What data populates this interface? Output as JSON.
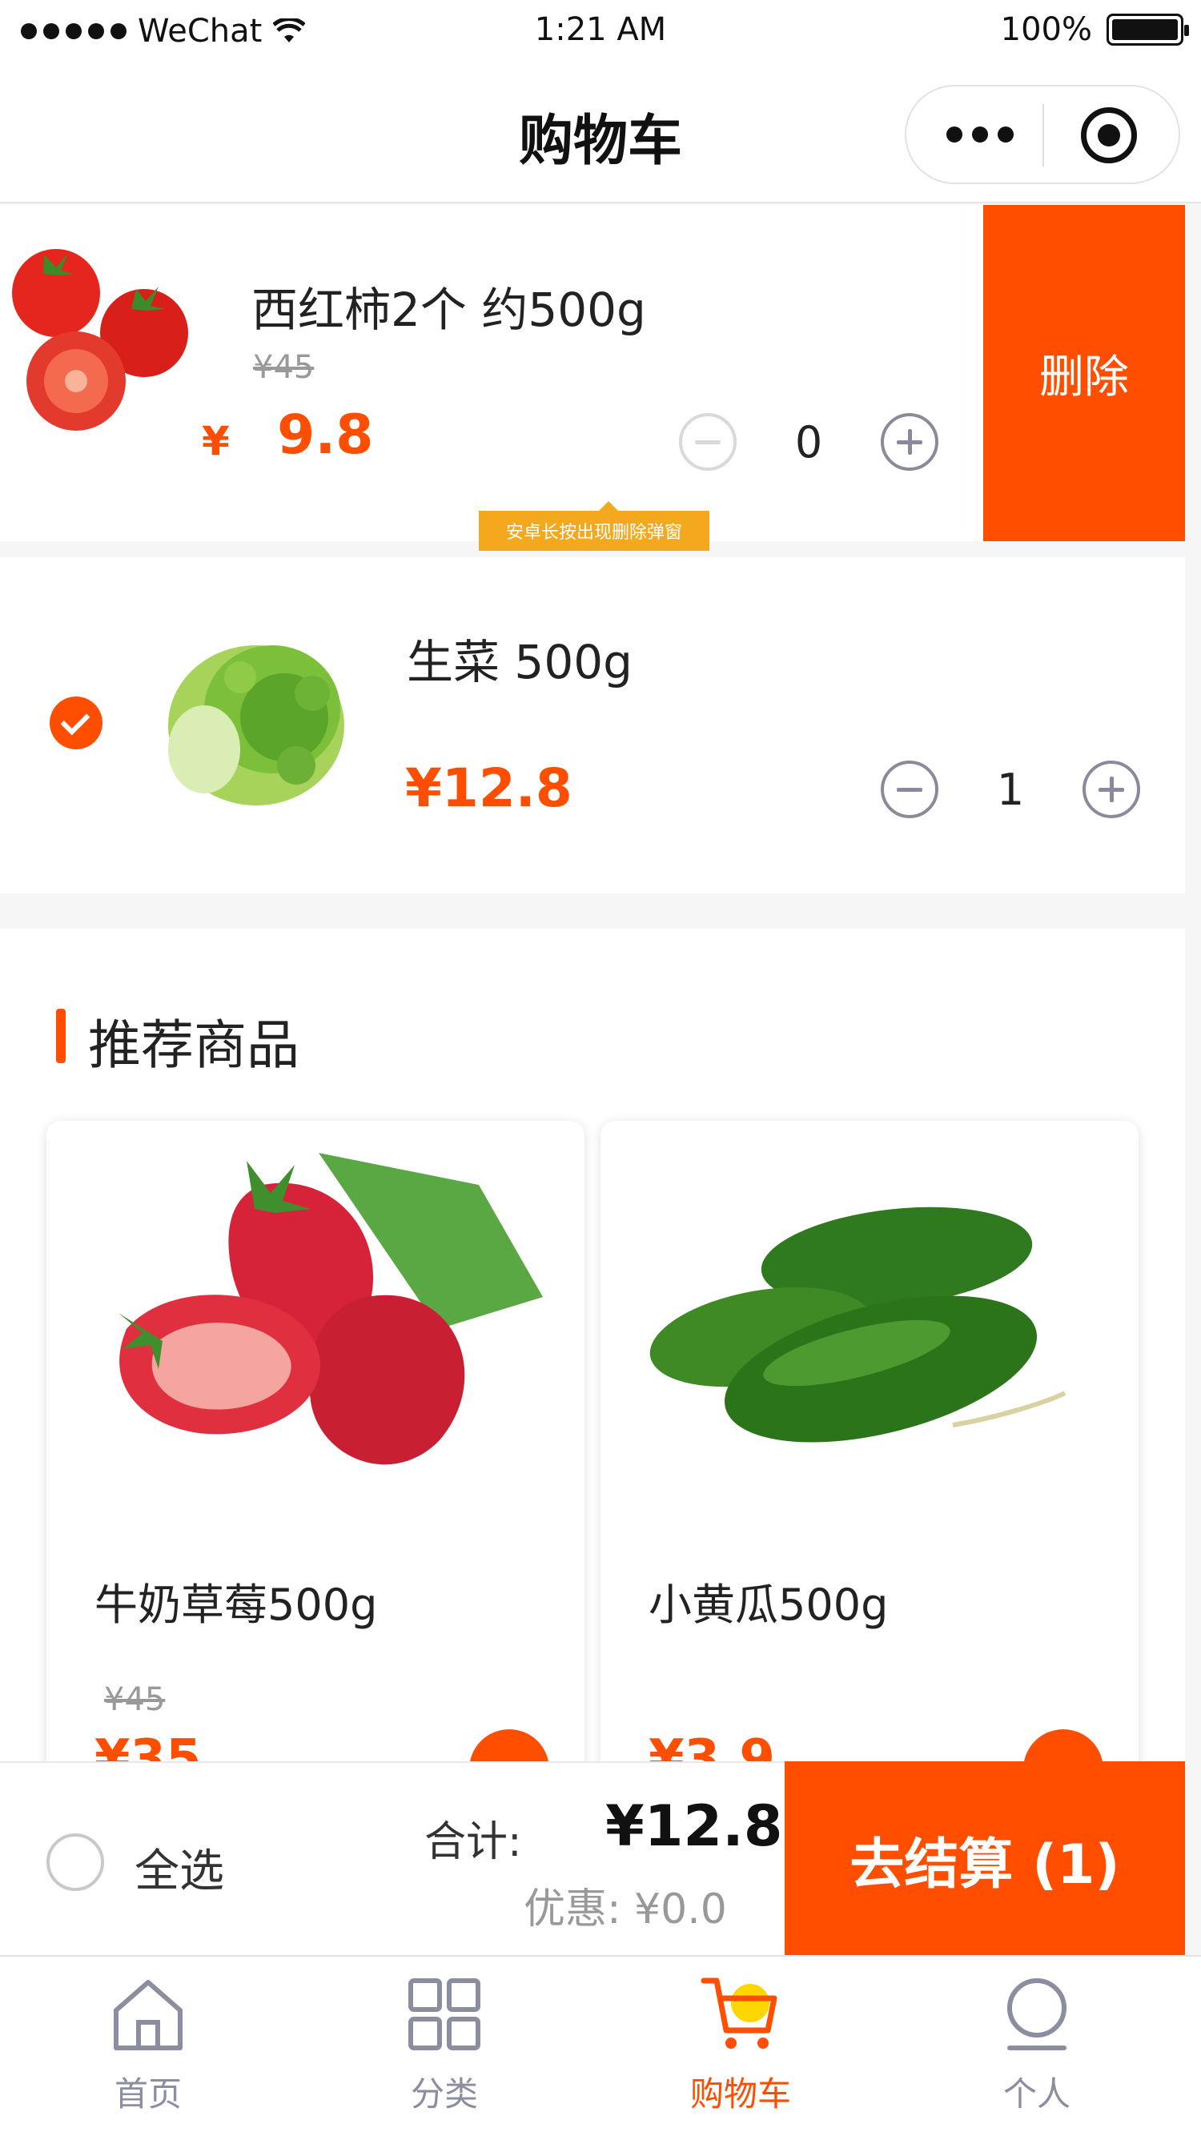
{
  "status_bar": {
    "carrier": "WeChat",
    "time": "1:21 AM",
    "battery": "100%"
  },
  "nav": {
    "title": "购物车"
  },
  "cart_items": [
    {
      "name": "西红柿2个 约500g",
      "old_price": "¥45",
      "currency": "¥",
      "price": "9.8",
      "quantity": "0",
      "delete_label": "删除",
      "checked": false
    },
    {
      "name": "生菜 500g",
      "price": "¥12.8",
      "quantity": "1",
      "checked": true
    }
  ],
  "tooltip": "安卓长按出现删除弹窗",
  "recommend": {
    "title": "推荐商品",
    "items": [
      {
        "name": "牛奶草莓500g",
        "old_price": "¥45",
        "price": "¥35"
      },
      {
        "name": "小黄瓜500g",
        "price": "¥3.9"
      }
    ]
  },
  "checkout": {
    "select_all": "全选",
    "total_label": "合计:",
    "total_value": "¥12.8",
    "discount": "优惠: ¥0.0",
    "button": "去结算 (1)"
  },
  "tabs": [
    {
      "label": "首页",
      "icon": "home-icon"
    },
    {
      "label": "分类",
      "icon": "category-grid-icon"
    },
    {
      "label": "购物车",
      "icon": "cart-icon",
      "active": true
    },
    {
      "label": "个人",
      "icon": "profile-icon"
    }
  ],
  "colors": {
    "accent": "#ff4e00",
    "tooltip": "#f4a81d",
    "tab_inactive": "#8a8e9e"
  }
}
